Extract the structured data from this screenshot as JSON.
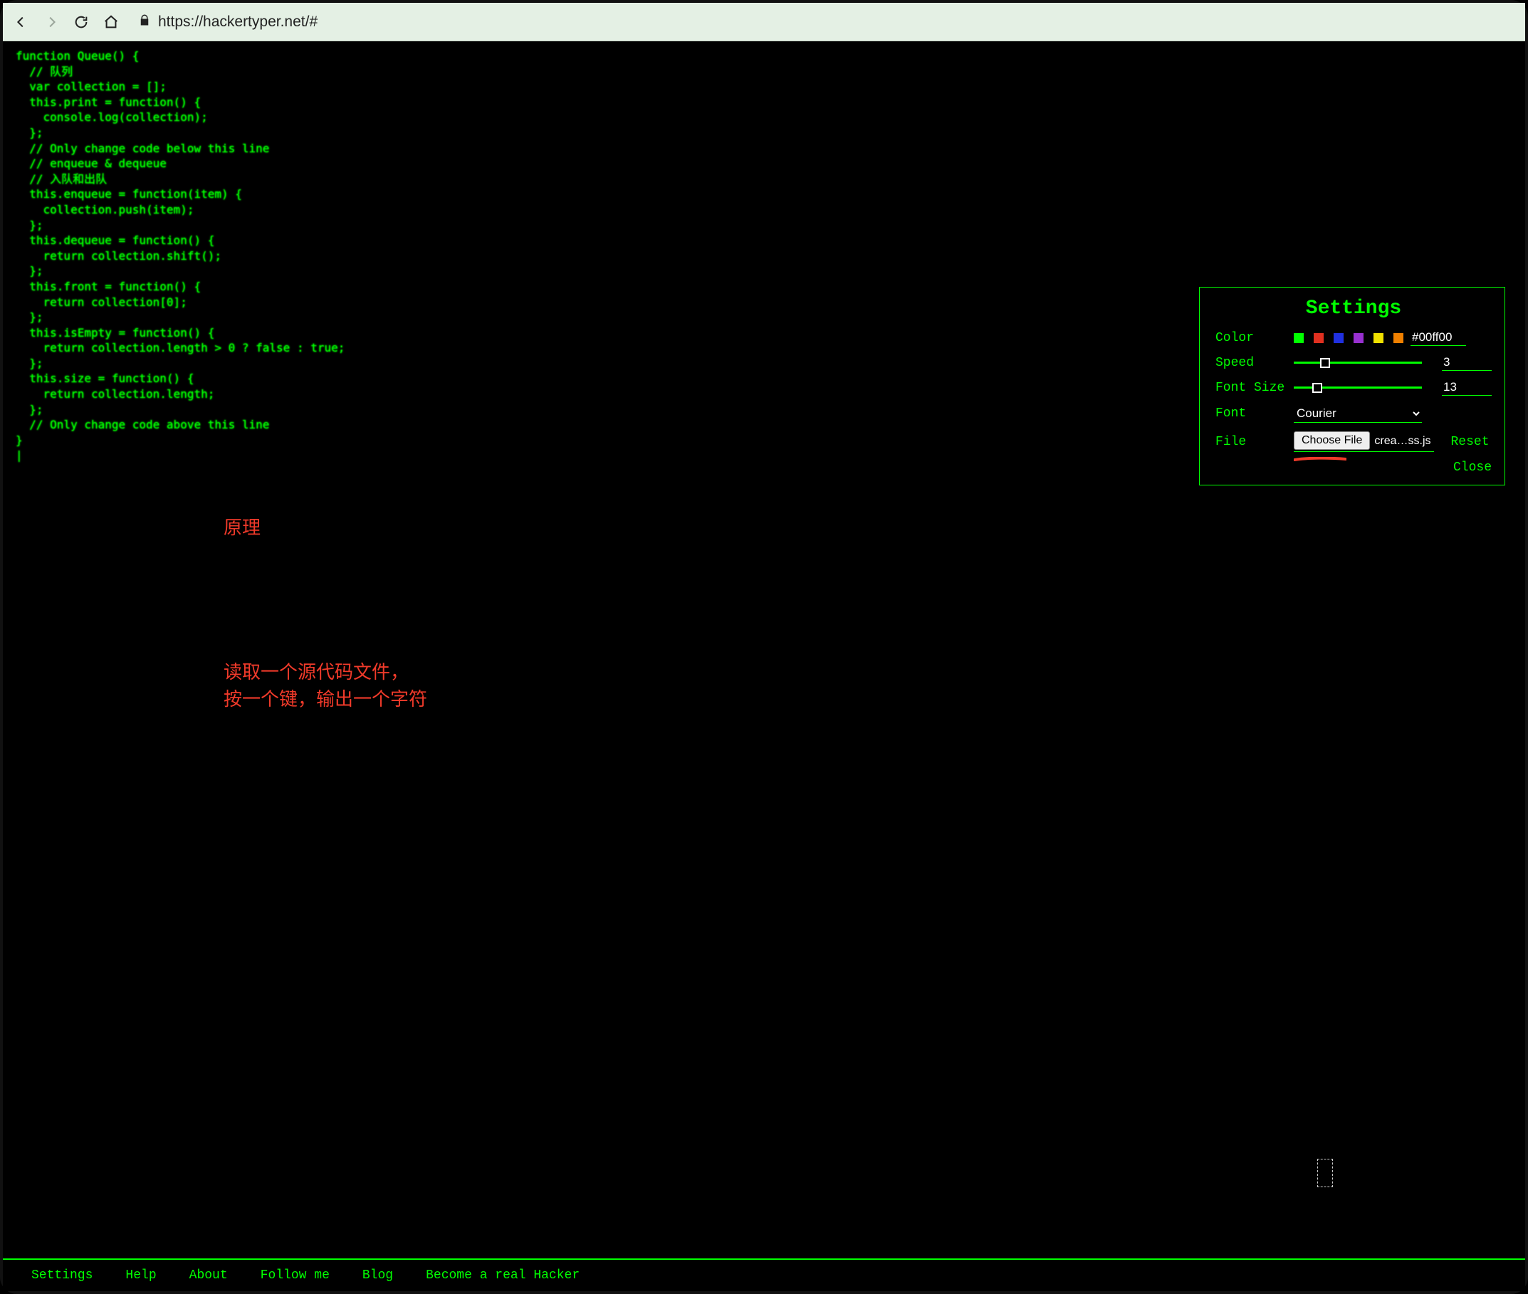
{
  "browser": {
    "url": "https://hackertyper.net/#"
  },
  "code": "function Queue() {\n  // 队列\n  var collection = [];\n  this.print = function() {\n    console.log(collection);\n  };\n  // Only change code below this line\n  // enqueue & dequeue\n  // 入队和出队\n  this.enqueue = function(item) {\n    collection.push(item);\n  };\n  this.dequeue = function() {\n    return collection.shift();\n  };\n  this.front = function() {\n    return collection[0];\n  };\n  this.isEmpty = function() {\n    return collection.length > 0 ? false : true;\n  };\n  this.size = function() {\n    return collection.length;\n  };\n  // Only change code above this line\n}\n|",
  "annotation": {
    "title": "原理",
    "body": "读取一个源代码文件，\n按一个键，输出一个字符"
  },
  "settings": {
    "title": "Settings",
    "labels": {
      "color": "Color",
      "speed": "Speed",
      "fontSize": "Font Size",
      "font": "Font",
      "file": "File"
    },
    "swatches": [
      "#00ff00",
      "#e03020",
      "#2030e0",
      "#9830d0",
      "#f0e000",
      "#f08000"
    ],
    "colorValue": "#00ff00",
    "speedValue": "3",
    "fontSizeValue": "13",
    "fontValue": "Courier",
    "chooseFileLabel": "Choose File",
    "fileName": "crea…ss.js",
    "resetLabel": "Reset",
    "closeLabel": "Close"
  },
  "footer": {
    "items": [
      "Settings",
      "Help",
      "About",
      "Follow me",
      "Blog",
      "Become a real Hacker"
    ]
  }
}
